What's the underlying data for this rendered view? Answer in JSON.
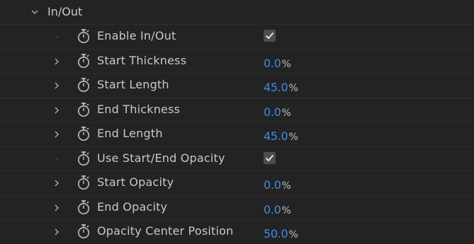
{
  "group": {
    "label": "In/Out",
    "expanded": true,
    "twirl_icon": "chevron-down-icon"
  },
  "colors": {
    "background": "#232323",
    "text": "#c8c8c8",
    "value": "#3f8be0",
    "checkbox_bg": "#4d4d4d"
  },
  "properties": [
    {
      "label": "Enable In/Out",
      "type": "checkbox",
      "checked": true,
      "twirl": false
    },
    {
      "label": "Start Thickness",
      "type": "number",
      "value": "0.0",
      "unit": "%",
      "twirl": true
    },
    {
      "label": "Start Length",
      "type": "number",
      "value": "45.0",
      "unit": "%",
      "twirl": true
    },
    {
      "label": "End Thickness",
      "type": "number",
      "value": "0.0",
      "unit": "%",
      "twirl": true
    },
    {
      "label": "End Length",
      "type": "number",
      "value": "45.0",
      "unit": "%",
      "twirl": true
    },
    {
      "label": "Use Start/End Opacity",
      "type": "checkbox",
      "checked": true,
      "twirl": false
    },
    {
      "label": "Start Opacity",
      "type": "number",
      "value": "0.0",
      "unit": "%",
      "twirl": true
    },
    {
      "label": "End Opacity",
      "type": "number",
      "value": "0.0",
      "unit": "%",
      "twirl": true
    },
    {
      "label": "Opacity Center Position",
      "type": "number",
      "value": "50.0",
      "unit": "%",
      "twirl": true
    }
  ]
}
